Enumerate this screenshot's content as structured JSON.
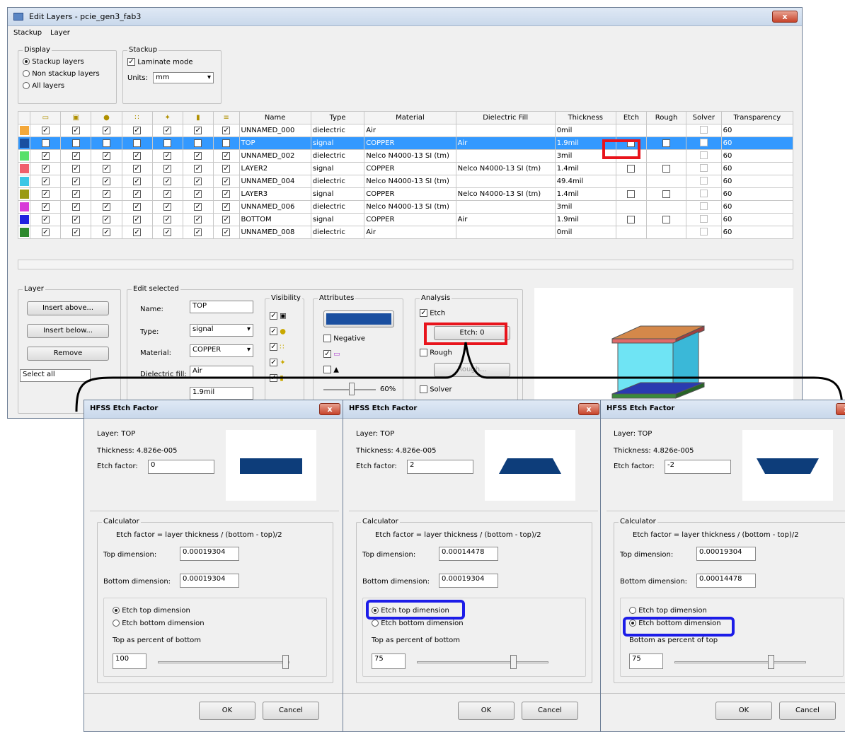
{
  "main": {
    "title": "Edit Layers - pcie_gen3_fab3",
    "close": "x",
    "menu": [
      "Stackup",
      "Layer"
    ],
    "display": {
      "label": "Display",
      "options": [
        "Stackup layers",
        "Non stackup layers",
        "All layers"
      ],
      "selected": 0
    },
    "stackup": {
      "label": "Stackup",
      "laminate_label": "Laminate mode",
      "laminate_checked": true,
      "units_label": "Units:",
      "units_value": "mm"
    },
    "grid": {
      "icon_headers": [
        "eye-icon",
        "layer-icon",
        "circle-icon",
        "dots-icon",
        "star-icon",
        "square-icon",
        "stack-icon"
      ],
      "columns": [
        "Name",
        "Type",
        "Material",
        "Dielectric Fill",
        "Thickness",
        "Etch",
        "Rough",
        "Solver",
        "Transparency"
      ],
      "rows": [
        {
          "color": "#f4a83a",
          "name": "UNNAMED_000",
          "type": "dielectric",
          "material": "Air",
          "fill": "",
          "thickness": "0mil",
          "etch": null,
          "rough": null,
          "transparency": "60"
        },
        {
          "color": "#1a4fa0",
          "name": "TOP",
          "type": "signal",
          "material": "COPPER",
          "fill": "Air",
          "thickness": "1.9mil",
          "etch": true,
          "rough": false,
          "transparency": "60",
          "selected": true
        },
        {
          "color": "#56e06a",
          "name": "UNNAMED_002",
          "type": "dielectric",
          "material": "Nelco N4000-13 SI (tm)",
          "fill": "",
          "thickness": "3mil",
          "etch": null,
          "rough": null,
          "transparency": "60"
        },
        {
          "color": "#f0606c",
          "name": "LAYER2",
          "type": "signal",
          "material": "COPPER",
          "fill": "Nelco N4000-13 SI (tm)",
          "thickness": "1.4mil",
          "etch": false,
          "rough": false,
          "transparency": "60"
        },
        {
          "color": "#3ac7e6",
          "name": "UNNAMED_004",
          "type": "dielectric",
          "material": "Nelco N4000-13 SI (tm)",
          "fill": "",
          "thickness": "49.4mil",
          "etch": null,
          "rough": null,
          "transparency": "60"
        },
        {
          "color": "#9a9a14",
          "name": "LAYER3",
          "type": "signal",
          "material": "COPPER",
          "fill": "Nelco N4000-13 SI (tm)",
          "thickness": "1.4mil",
          "etch": false,
          "rough": false,
          "transparency": "60"
        },
        {
          "color": "#d83ad8",
          "name": "UNNAMED_006",
          "type": "dielectric",
          "material": "Nelco N4000-13 SI (tm)",
          "fill": "",
          "thickness": "3mil",
          "etch": null,
          "rough": null,
          "transparency": "60"
        },
        {
          "color": "#2020e0",
          "name": "BOTTOM",
          "type": "signal",
          "material": "COPPER",
          "fill": "Air",
          "thickness": "1.9mil",
          "etch": false,
          "rough": false,
          "transparency": "60"
        },
        {
          "color": "#2e8a2e",
          "name": "UNNAMED_008",
          "type": "dielectric",
          "material": "Air",
          "fill": "",
          "thickness": "0mil",
          "etch": null,
          "rough": null,
          "transparency": "60"
        }
      ]
    },
    "layer": {
      "label": "Layer",
      "insert_above": "Insert above...",
      "insert_below": "Insert below...",
      "remove": "Remove",
      "select_all": "Select all"
    },
    "edit": {
      "label": "Edit selected",
      "name_label": "Name:",
      "name_value": "TOP",
      "type_label": "Type:",
      "type_value": "signal",
      "material_label": "Material:",
      "material_value": "COPPER",
      "fill_label": "Dielectric fill:",
      "fill_value": "Air",
      "thickness_value": "1.9mil"
    },
    "visibility": {
      "label": "Visibility"
    },
    "attributes": {
      "label": "Attributes",
      "negative": "Negative",
      "transparency": "60%"
    },
    "analysis": {
      "label": "Analysis",
      "etch": "Etch",
      "etch_btn": "Etch: 0",
      "rough": "Rough",
      "rough_btn": "Rough...",
      "solver": "Solver"
    }
  },
  "dialogs": [
    {
      "title": "HFSS Etch Factor",
      "close": "x",
      "layer": "Layer: TOP",
      "thickness": "Thickness: 4.826e-005",
      "etch_label": "Etch factor:",
      "etch_value": "0",
      "calc_label": "Calculator",
      "formula": "Etch factor = layer thickness / (bottom - top)/2",
      "top_label": "Top dimension:",
      "top_value": "0.00019304",
      "bottom_label": "Bottom dimension:",
      "bottom_value": "0.00019304",
      "opt1": "Etch top dimension",
      "opt2": "Etch bottom dimension",
      "selected": 0,
      "pct_label": "Top as percent of bottom",
      "pct_value": "100",
      "pct": 1.0,
      "ok": "OK",
      "cancel": "Cancel",
      "shape": "rect"
    },
    {
      "title": "HFSS Etch Factor",
      "close": "x",
      "layer": "Layer: TOP",
      "thickness": "Thickness: 4.826e-005",
      "etch_label": "Etch factor:",
      "etch_value": "2",
      "calc_label": "Calculator",
      "formula": "Etch factor = layer thickness / (bottom - top)/2",
      "top_label": "Top dimension:",
      "top_value": "0.00014478",
      "bottom_label": "Bottom dimension:",
      "bottom_value": "0.00019304",
      "opt1": "Etch top dimension",
      "opt2": "Etch bottom dimension",
      "selected": 0,
      "pct_label": "Top as percent of bottom",
      "pct_value": "75",
      "pct": 0.75,
      "ok": "OK",
      "cancel": "Cancel",
      "shape": "trap-up"
    },
    {
      "title": "HFSS Etch Factor",
      "close": "x",
      "layer": "Layer: TOP",
      "thickness": "Thickness: 4.826e-005",
      "etch_label": "Etch factor:",
      "etch_value": "-2",
      "calc_label": "Calculator",
      "formula": "Etch factor = layer thickness / (bottom - top)/2",
      "top_label": "Top dimension:",
      "top_value": "0.00019304",
      "bottom_label": "Bottom dimension:",
      "bottom_value": "0.00014478",
      "opt1": "Etch top dimension",
      "opt2": "Etch bottom dimension",
      "selected": 1,
      "pct_label": "Bottom as percent of top",
      "pct_value": "75",
      "pct": 0.75,
      "ok": "OK",
      "cancel": "Cancel",
      "shape": "trap-down"
    }
  ]
}
